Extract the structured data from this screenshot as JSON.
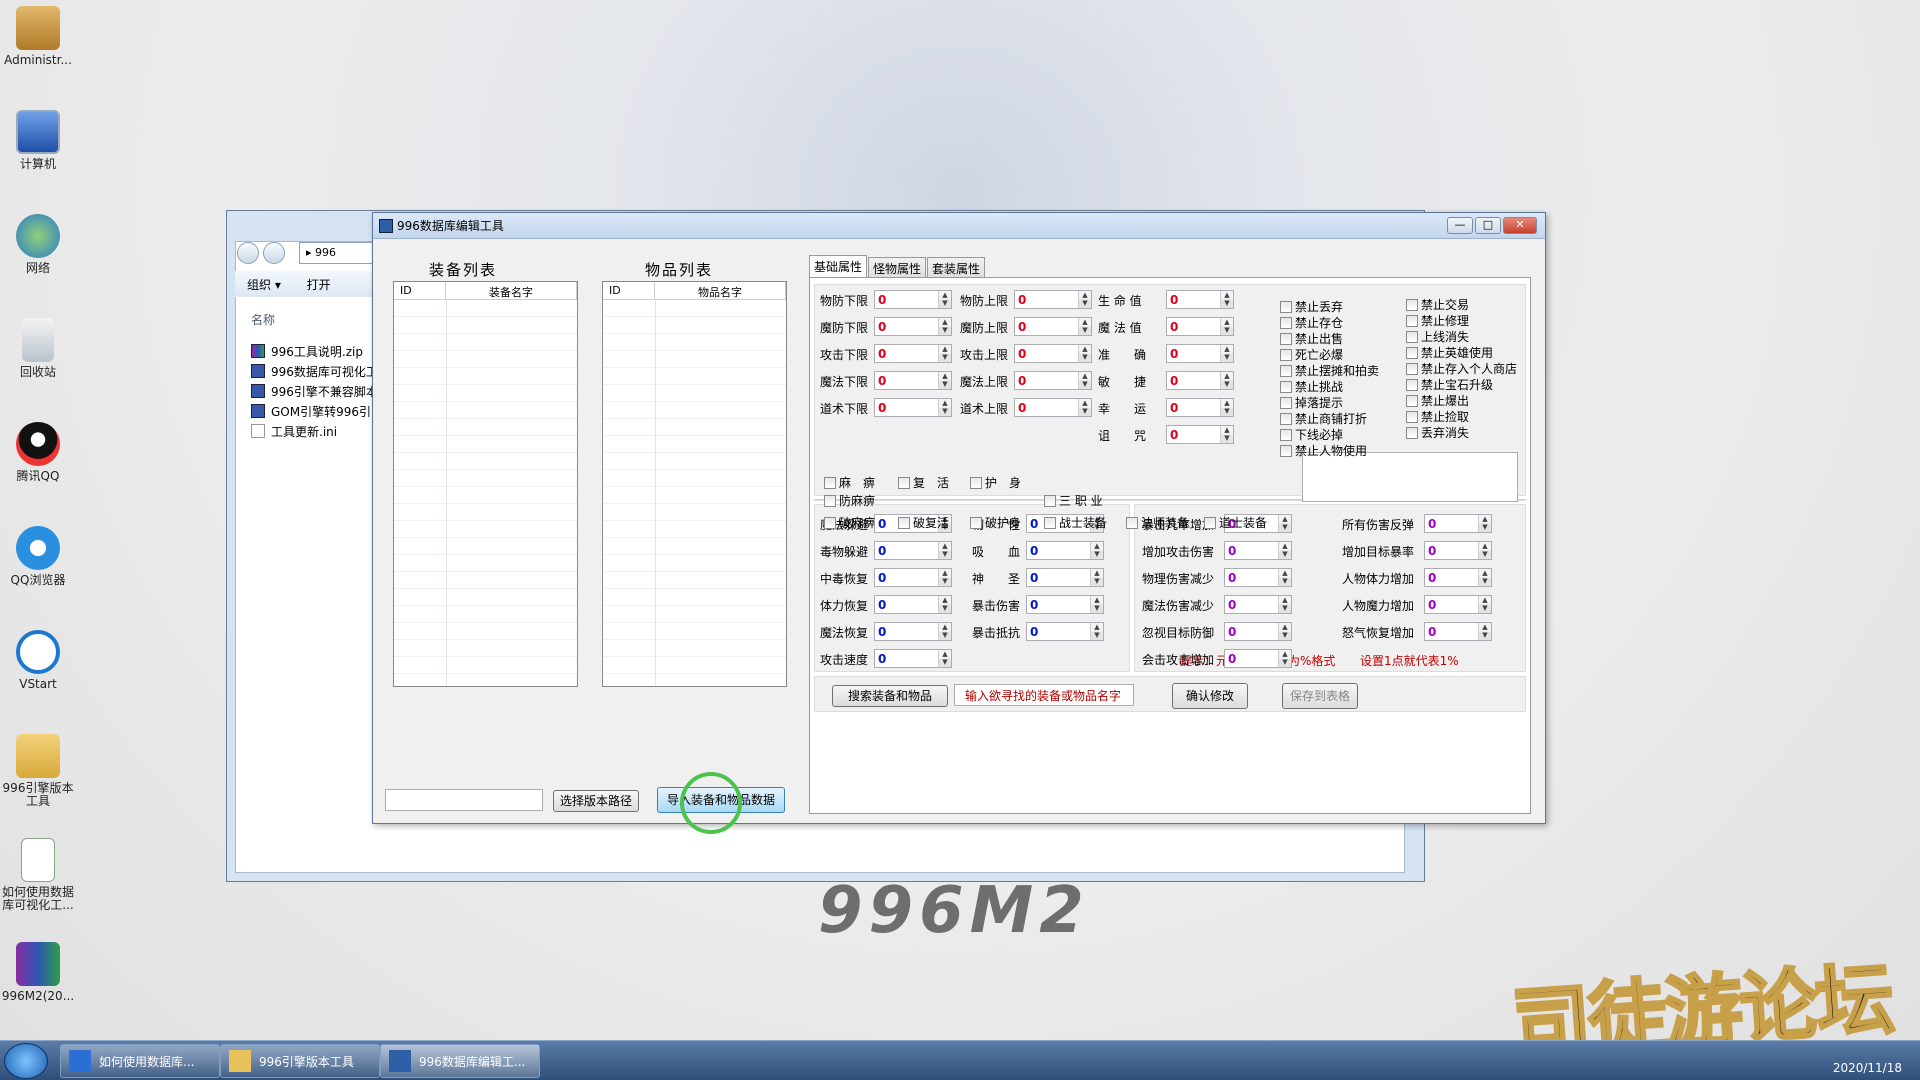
{
  "desktop": {
    "icons": [
      {
        "label": "Administr...",
        "icon": "user-folder-icon"
      },
      {
        "label": "计算机",
        "icon": "computer-icon"
      },
      {
        "label": "网络",
        "icon": "network-icon"
      },
      {
        "label": "回收站",
        "icon": "recycle-bin-icon"
      },
      {
        "label": "腾讯QQ",
        "icon": "qq-icon"
      },
      {
        "label": "QQ浏览器",
        "icon": "qq-browser-icon"
      },
      {
        "label": "VStart",
        "icon": "vstart-icon"
      },
      {
        "label": "996引擎版本工具",
        "icon": "folder-icon"
      },
      {
        "label": "如何使用数据库可视化工...",
        "icon": "document-icon"
      },
      {
        "label": "996M2(20...",
        "icon": "rar-icon"
      }
    ],
    "watermark": "996M2",
    "logo": "司徒游论坛"
  },
  "explorer": {
    "address": "996",
    "toolbar": {
      "organize": "组织 ▾",
      "open": "打开"
    },
    "column_header": "名称",
    "files": [
      {
        "name": "996工具说明.zip",
        "type": "zip"
      },
      {
        "name": "996数据库可视化工",
        "type": "exe"
      },
      {
        "name": "996引擎不兼容脚本",
        "type": "exe"
      },
      {
        "name": "GOM引擎转996引",
        "type": "exe"
      },
      {
        "name": "工具更新.ini",
        "type": "txt"
      }
    ]
  },
  "editor": {
    "title": "996数据库编辑工具",
    "window_buttons": {
      "min": "—",
      "max": "□",
      "close": "✕"
    },
    "equip_list": {
      "title": "装备列表",
      "col_id": "ID",
      "col_name": "装备名字"
    },
    "item_list": {
      "title": "物品列表",
      "col_id": "ID",
      "col_name": "物品名字"
    },
    "path_value": "",
    "btn_select_path": "选择版本路径",
    "btn_import": "导入装备和物品数据",
    "tabs": [
      "基础属性",
      "怪物属性",
      "套装属性"
    ],
    "active_tab": 0,
    "base_col1": [
      {
        "label": "物防下限",
        "value": "0"
      },
      {
        "label": "魔防下限",
        "value": "0"
      },
      {
        "label": "攻击下限",
        "value": "0"
      },
      {
        "label": "魔法下限",
        "value": "0"
      },
      {
        "label": "道术下限",
        "value": "0"
      }
    ],
    "base_col2": [
      {
        "label": "物防上限",
        "value": "0"
      },
      {
        "label": "魔防上限",
        "value": "0"
      },
      {
        "label": "攻击上限",
        "value": "0"
      },
      {
        "label": "魔法上限",
        "value": "0"
      },
      {
        "label": "道术上限",
        "value": "0"
      }
    ],
    "base_col3": [
      {
        "label": "生 命 值",
        "value": "0"
      },
      {
        "label": "魔 法 值",
        "value": "0"
      },
      {
        "label": "准　　确",
        "value": "0"
      },
      {
        "label": "敏　　捷",
        "value": "0"
      },
      {
        "label": "幸　　运",
        "value": "0"
      },
      {
        "label": "诅　　咒",
        "value": "0"
      }
    ],
    "forbid_col1": [
      "禁止丢弃",
      "禁止存仓",
      "禁止出售",
      "死亡必爆",
      "禁止摆摊和拍卖",
      "禁止挑战",
      "掉落提示",
      "禁止商铺打折",
      "下线必掉",
      "禁止人物使用"
    ],
    "forbid_col2": [
      "禁止交易",
      "禁止修理",
      "上线消失",
      "禁止英雄使用",
      "禁止存入个人商店",
      "禁止宝石升级",
      "禁止爆出",
      "禁止捡取",
      "丢弃消失"
    ],
    "special_row1": [
      "麻　痹",
      "复　活",
      "护　身"
    ],
    "special_row2": [
      "防麻痹",
      "三 职 业"
    ],
    "special_row3": [
      "破麻痹",
      "破复活",
      "破护身",
      "战士装备",
      "法师装备",
      "道士装备"
    ],
    "adv_col1": [
      {
        "label": "魔法躲避",
        "value": "0"
      },
      {
        "label": "毒物躲避",
        "value": "0"
      },
      {
        "label": "中毒恢复",
        "value": "0"
      },
      {
        "label": "体力恢复",
        "value": "0"
      },
      {
        "label": "魔法恢复",
        "value": "0"
      },
      {
        "label": "攻击速度",
        "value": "0"
      }
    ],
    "adv_col2": [
      {
        "label": "韧　　性",
        "value": "0"
      },
      {
        "label": "吸　　血",
        "value": "0"
      },
      {
        "label": "神　　圣",
        "value": "0"
      },
      {
        "label": "暴击伤害",
        "value": "0"
      },
      {
        "label": "暴击抵抗",
        "value": "0"
      }
    ],
    "elem_col1": [
      {
        "label": "暴击几率增加",
        "value": "0"
      },
      {
        "label": "增加攻击伤害",
        "value": "0"
      },
      {
        "label": "物理伤害减少",
        "value": "0"
      },
      {
        "label": "魔法伤害减少",
        "value": "0"
      },
      {
        "label": "忽视目标防御",
        "value": "0"
      },
      {
        "label": "会击攻击增加",
        "value": "0"
      }
    ],
    "elem_col2": [
      {
        "label": "所有伤害反弹",
        "value": "0"
      },
      {
        "label": "增加目标暴率",
        "value": "0"
      },
      {
        "label": "人物体力增加",
        "value": "0"
      },
      {
        "label": "人物魔力增加",
        "value": "0"
      },
      {
        "label": "怒气恢复增加",
        "value": "0"
      }
    ],
    "tip1": "提示：元素属性格式为%格式",
    "tip2": "设置1点就代表1%",
    "btn_search": "搜索装备和物品",
    "search_placeholder": "输入欲寻找的装备或物品名字",
    "btn_confirm": "确认修改",
    "btn_save_table": "保存到表格"
  },
  "taskbar": {
    "items": [
      {
        "label": "如何使用数据库...",
        "icon": "wps-icon"
      },
      {
        "label": "996引擎版本工具",
        "icon": "folder-icon"
      },
      {
        "label": "996数据库编辑工...",
        "icon": "app-icon"
      }
    ],
    "time": "2020/11/18"
  }
}
